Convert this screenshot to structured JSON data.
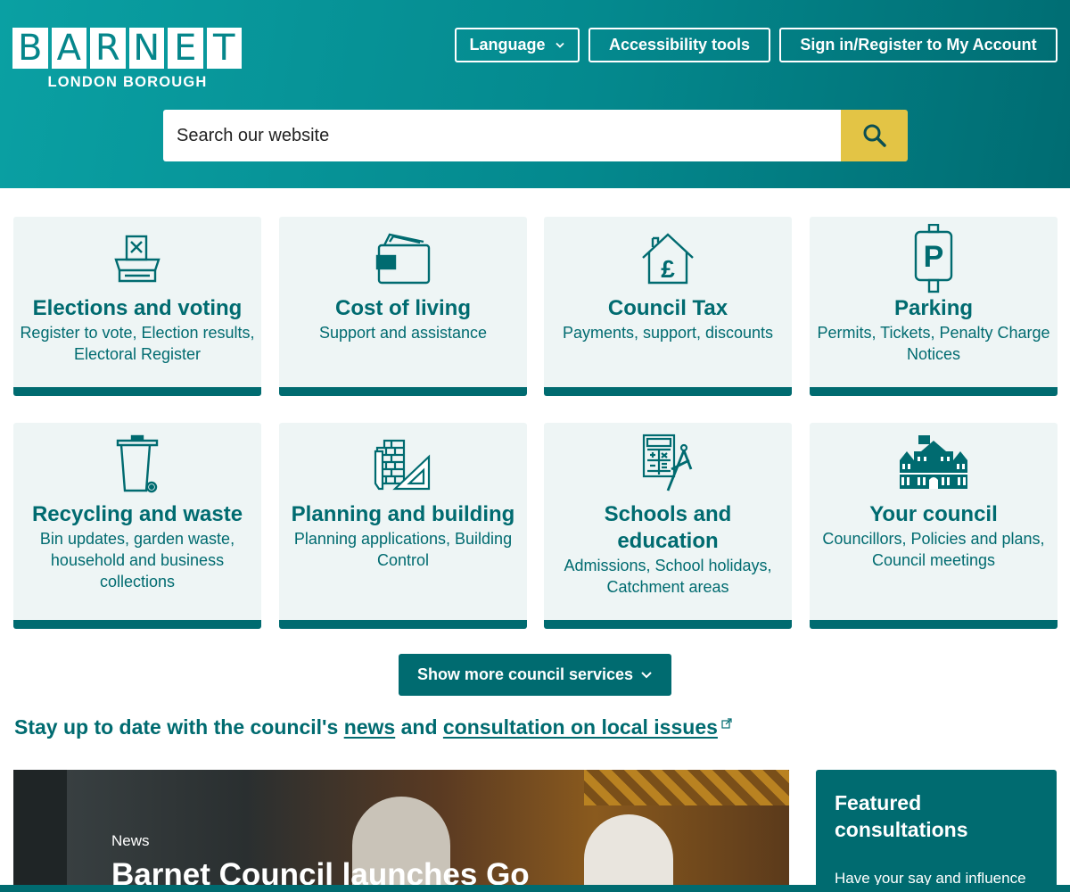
{
  "header": {
    "logo": {
      "letters": [
        "B",
        "A",
        "R",
        "N",
        "E",
        "T"
      ],
      "subtitle": "LONDON BOROUGH",
      "name": "BARNET"
    },
    "language_label": "Language",
    "accessibility_label": "Accessibility tools",
    "signin_label": "Sign in/Register to My Account",
    "search_placeholder": "Search our website"
  },
  "services": [
    {
      "icon": "ballot-box-icon",
      "title": "Elections and voting",
      "description": "Register to vote, Election results, Electoral Register"
    },
    {
      "icon": "wallet-icon",
      "title": "Cost of living",
      "description": "Support and assistance"
    },
    {
      "icon": "house-pound-icon",
      "title": "Council Tax",
      "description": "Payments, support, discounts"
    },
    {
      "icon": "parking-sign-icon",
      "title": "Parking",
      "description": "Permits, Tickets, Penalty Charge Notices"
    },
    {
      "icon": "wheelie-bin-icon",
      "title": "Recycling and waste",
      "description": "Bin updates, garden waste, household and business collections"
    },
    {
      "icon": "bricks-ruler-icon",
      "title": "Planning and building",
      "description": "Planning applications, Building Control"
    },
    {
      "icon": "calculator-compass-icon",
      "title": "Schools and education",
      "description": "Admissions, School holidays, Catchment areas"
    },
    {
      "icon": "town-hall-icon",
      "title": "Your council",
      "description": "Councillors, Policies and plans, Council meetings"
    }
  ],
  "more_services_label": "Show more council services",
  "stay_updated": {
    "prefix": "Stay up to date with the council's",
    "news_link": "news",
    "middle": "and",
    "consultation_link": "consultation on local issues"
  },
  "news": {
    "tag": "News",
    "title": "Barnet Council launches Go"
  },
  "featured": {
    "title": "Featured consultations",
    "text": "Have your say and influence"
  },
  "colors": {
    "teal_dark": "#006b70",
    "teal_light": "#0aa0a3",
    "search_yellow": "#e3c445",
    "card_bg": "#eef5f5"
  }
}
